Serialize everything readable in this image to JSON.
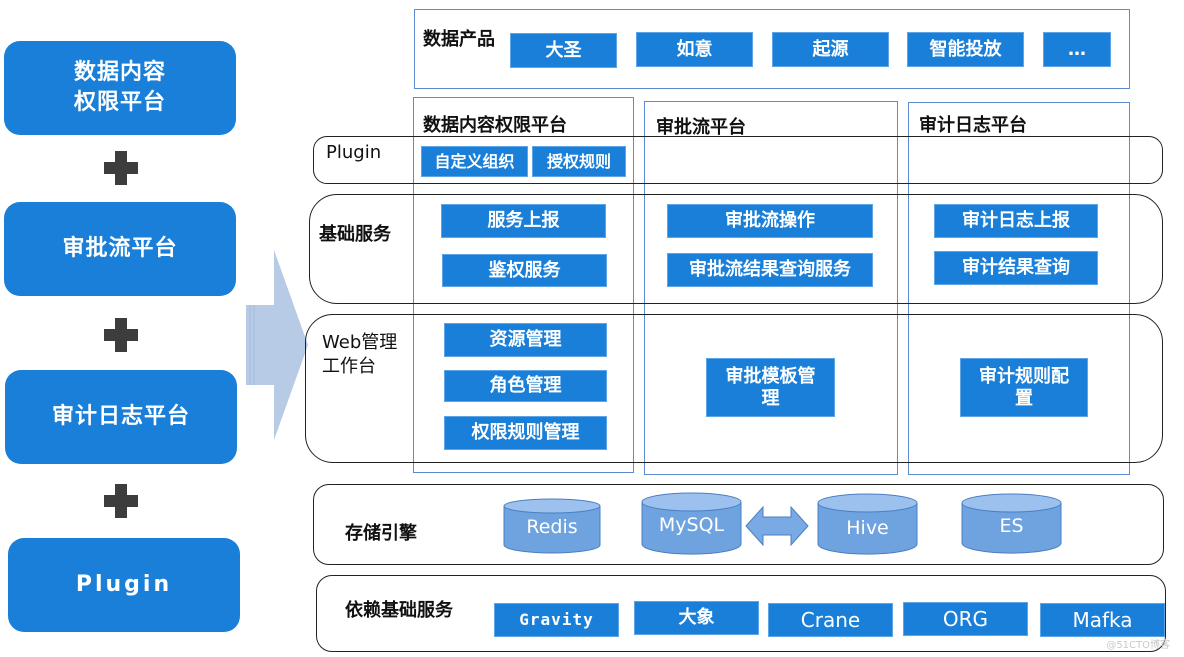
{
  "left_stack": [
    {
      "label_line1": "数据内容",
      "label_line2": "权限平台"
    },
    {
      "label": "审批流平台"
    },
    {
      "label": "审计日志平台"
    },
    {
      "label": "Plugin"
    }
  ],
  "top_products": {
    "title": "数据产品",
    "items": [
      "大圣",
      "如意",
      "起源",
      "智能投放",
      "…"
    ]
  },
  "columns": [
    {
      "title": "数据内容权限平台"
    },
    {
      "title": "审批流平台"
    },
    {
      "title": "审计日志平台"
    }
  ],
  "rows": {
    "plugin": {
      "label": "Plugin",
      "col1": [
        "自定义组织",
        "授权规则"
      ]
    },
    "base_services": {
      "label": "基础服务",
      "col1": [
        "服务上报",
        "鉴权服务"
      ],
      "col2": [
        "审批流操作",
        "审批流结果查询服务"
      ],
      "col3": [
        "审计日志上报",
        "审计结果查询"
      ]
    },
    "web_console": {
      "label_line1": "Web管理",
      "label_line2": "工作台",
      "col1": [
        "资源管理",
        "角色管理",
        "权限规则管理"
      ],
      "col2": {
        "line1": "审批模板管",
        "line2": "理"
      },
      "col3": {
        "line1": "审计规则配",
        "line2": "置"
      }
    },
    "storage": {
      "label": "存储引擎",
      "engines": [
        "Redis",
        "MySQL",
        "Hive",
        "ES"
      ],
      "sync_arrow": "bidirectional-arrow MySQL-Hive"
    },
    "dependencies": {
      "label": "依赖基础服务",
      "items": [
        "Gravity",
        "大象",
        "Crane",
        "ORG",
        "Mafka"
      ]
    }
  },
  "watermark": "@51CTO博客",
  "colors": {
    "primary_blue": "#1a7fd8",
    "frame_blue": "#5b8ccf",
    "cylinder_blue": "#6fa3e0",
    "arrow_blue": "#b7cbe6",
    "plus_gray": "#3d3d3d"
  }
}
